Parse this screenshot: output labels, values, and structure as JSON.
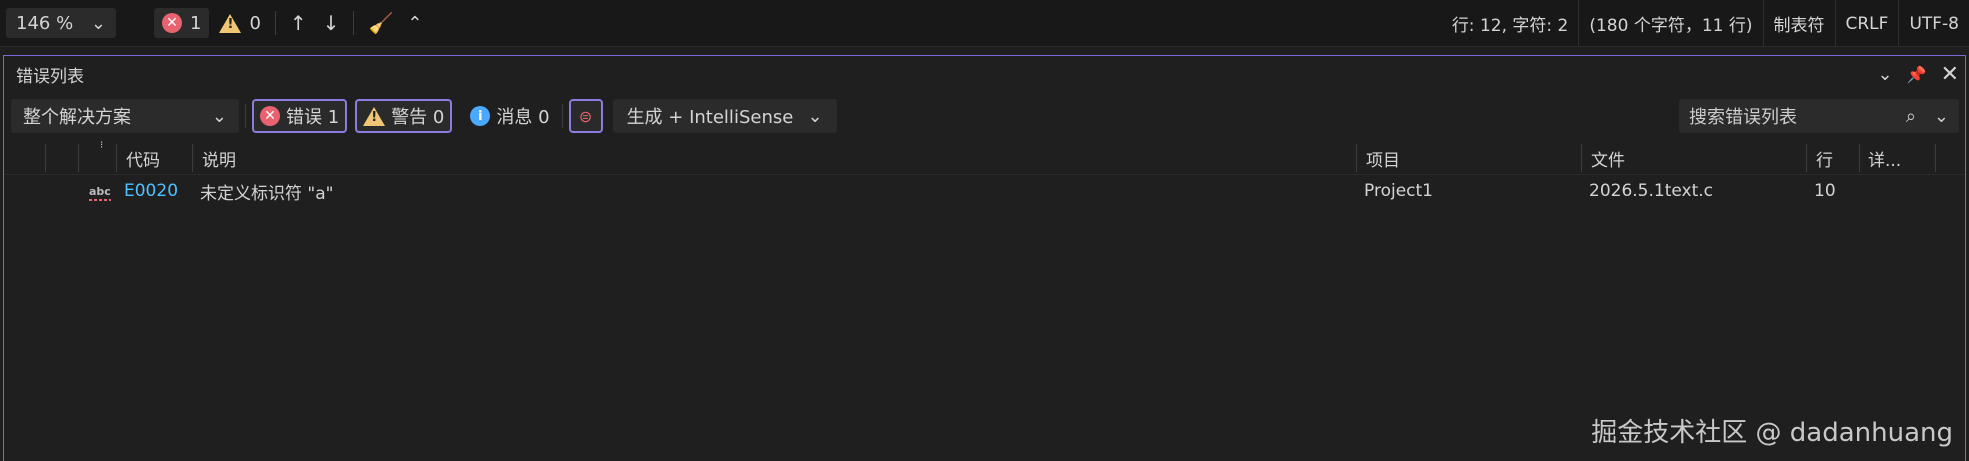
{
  "status_bar": {
    "zoom": "146 %",
    "errors": "1",
    "warnings": "0",
    "position": "行: 12, 字符: 2",
    "chars": "(180 个字符，11 行)",
    "indent": "制表符",
    "eol": "CRLF",
    "encoding": "UTF-8"
  },
  "panel": {
    "title": "错误列表",
    "scope": "整个解决方案",
    "errors_label": "错误 1",
    "warnings_label": "警告 0",
    "messages_label": "消息 0",
    "build_filter": "生成 + IntelliSense",
    "search_placeholder": "搜索错误列表"
  },
  "table": {
    "headers": {
      "code": "代码",
      "description": "说明",
      "project": "项目",
      "file": "文件",
      "line": "行",
      "detail": "详..."
    },
    "rows": [
      {
        "code": "E0020",
        "description": "未定义标识符 \"a\"",
        "project": "Project1",
        "file": "2026.5.1text.c",
        "line": "10"
      }
    ]
  },
  "watermark": "掘金技术社区 @ dadanhuang",
  "colors": {
    "accent": "#7b6ad6",
    "error": "#e8636f",
    "warning": "#f0c674",
    "info": "#4aa8ff",
    "link": "#4fc1ff"
  }
}
